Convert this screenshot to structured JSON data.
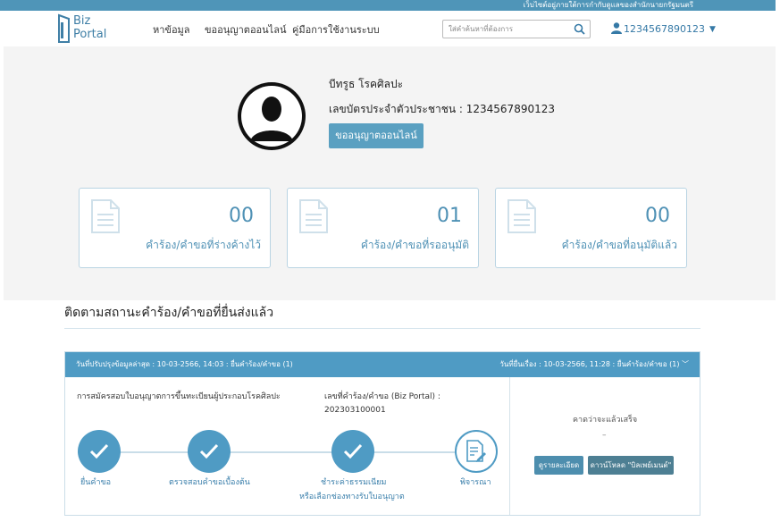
{
  "topbar": {
    "text": "เว็บไซต์อยู่ภายใต้การกำกับดูแลของสำนักนายกรัฐมนตรี"
  },
  "header": {
    "logo": {
      "line1": "Biz",
      "line2": "Portal"
    },
    "nav": [
      "หาข้อมูล",
      "ขออนุญาตออนไลน์",
      "คู่มือการใช้งานระบบ"
    ],
    "search": {
      "placeholder": "ใส่คำค้นหาที่ต้องการ",
      "icon": "search-icon"
    },
    "user": {
      "id": "1234567890123",
      "icon": "user-icon"
    }
  },
  "profile": {
    "name": "บีทรูธ โรคศิลปะ",
    "id_label": "เลขบัตรประจำตัวประชาชน :",
    "id_value": "1234567890123",
    "button": "ขออนุญาตออนไลน์"
  },
  "cards": [
    {
      "count": "00",
      "label": "คำร้อง/คำขอที่ร่างค้างไว้"
    },
    {
      "count": "01",
      "label": "คำร้อง/คำขอที่รออนุมัติ"
    },
    {
      "count": "00",
      "label": "คำร้อง/คำขอที่อนุมัติแล้ว"
    }
  ],
  "tracking": {
    "title": "ติดตามสถานะคำร้อง/คำขอที่ยื่นส่งแล้ว",
    "header_left": "วันที่ปรับปรุงข้อมูลล่าสุด : 10-03-2566, 14:03 : ยื่นคำร้อง/คำขอ (1)",
    "header_right": "วันที่ยื่นเรื่อง : 10-03-2566, 11:28 : ยื่นคำร้อง/คำขอ (1)",
    "request_title": "การสมัครสอบใบอนุญาตการขึ้นทะเบียนผู้ประกอบโรคศิลปะ",
    "request_no_label": "เลขที่คำร้อง/คำขอ (Biz Portal) :",
    "request_no": "202303100001",
    "steps": [
      {
        "label": "ยื่นคำขอ",
        "status": "done"
      },
      {
        "label": "ตรวจสอบคำขอเบื้องต้น",
        "status": "done"
      },
      {
        "label1": "ชำระค่าธรรมเนียม",
        "label2": "หรือเลือกช่องทางรับใบอนุญาต",
        "status": "done"
      },
      {
        "label": "พิจารณา",
        "status": "current"
      }
    ],
    "expected_label": "คาดว่าจะแล้วเสร็จ",
    "expected_value": "–",
    "detail_button": "ดูรายละเอียด",
    "download_button": "ดาวน์โหลด \"บิลเพย์เมนต์\""
  },
  "colors": {
    "primary": "#4f9bc4",
    "topbar": "#4f95b8",
    "profile_bg": "#f4f4f4",
    "avatar": "#111111"
  }
}
